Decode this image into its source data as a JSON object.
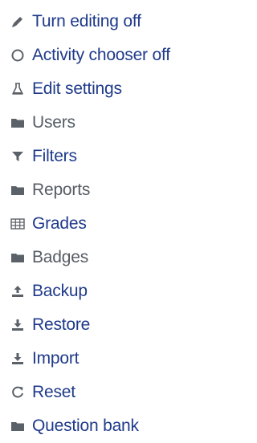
{
  "colors": {
    "link": "#1f3a8a",
    "plain": "#555c64",
    "icon": "#5b6168"
  },
  "menu": {
    "items": [
      {
        "label": "Turn editing off",
        "icon": "pencil-icon",
        "style": "link"
      },
      {
        "label": "Activity chooser off",
        "icon": "circle-icon",
        "style": "link"
      },
      {
        "label": "Edit settings",
        "icon": "flask-icon",
        "style": "link"
      },
      {
        "label": "Users",
        "icon": "folder-icon",
        "style": "plain"
      },
      {
        "label": "Filters",
        "icon": "filter-icon",
        "style": "link"
      },
      {
        "label": "Reports",
        "icon": "folder-icon",
        "style": "plain"
      },
      {
        "label": "Grades",
        "icon": "table-icon",
        "style": "link"
      },
      {
        "label": "Badges",
        "icon": "folder-icon",
        "style": "plain"
      },
      {
        "label": "Backup",
        "icon": "upload-icon",
        "style": "link"
      },
      {
        "label": "Restore",
        "icon": "download-icon",
        "style": "link"
      },
      {
        "label": "Import",
        "icon": "download-icon",
        "style": "link"
      },
      {
        "label": "Reset",
        "icon": "refresh-icon",
        "style": "link"
      },
      {
        "label": "Question bank",
        "icon": "folder-icon",
        "style": "link"
      }
    ]
  }
}
